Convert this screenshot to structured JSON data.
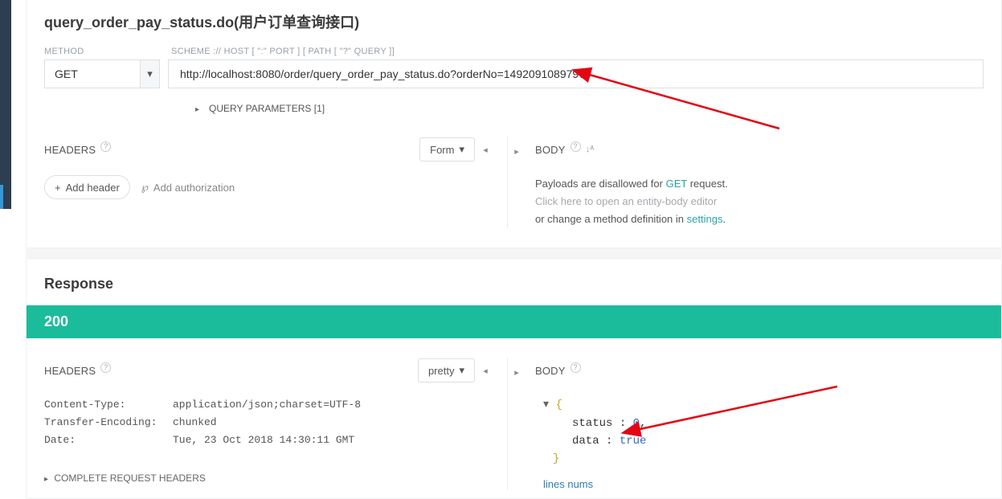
{
  "title": "query_order_pay_status.do(用户订单查询接口)",
  "labels": {
    "method": "METHOD",
    "scheme": "SCHEME :// HOST [ \":\" PORT ] [ PATH [ \"?\" QUERY ]]"
  },
  "method": "GET",
  "url": "http://localhost:8080/order/query_order_pay_status.do?orderNo=1492091089797",
  "query_params_label": "QUERY PARAMETERS [1]",
  "request": {
    "headers_title": "HEADERS",
    "form_label": "Form",
    "add_header": "Add header",
    "add_auth": "Add authorization",
    "body_title": "BODY",
    "note_line1_pre": "Payloads are disallowed for ",
    "note_line1_link": "GET",
    "note_line1_post": " request.",
    "note_line2": "Click here to open an entity-body editor",
    "note_line3_pre": "or change a method definition in ",
    "note_line3_link": "settings",
    "note_line3_post": "."
  },
  "response": {
    "title": "Response",
    "status": "200",
    "headers_title": "HEADERS",
    "pretty_label": "pretty",
    "body_title": "BODY",
    "headers": [
      {
        "key": "Content-Type:",
        "value": "application/json;charset=UTF-8"
      },
      {
        "key": "Transfer-Encoding:",
        "value": "chunked"
      },
      {
        "key": "Date:",
        "value": "Tue, 23 Oct 2018 14:30:11 GMT"
      }
    ],
    "complete_headers": "COMPLETE REQUEST HEADERS",
    "json": {
      "status_key": "status",
      "status_val": "0",
      "data_key": "data",
      "data_val": "true"
    },
    "lines_nums": "lines nums"
  }
}
